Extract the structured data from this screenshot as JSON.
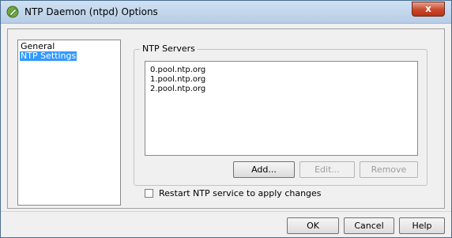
{
  "window": {
    "title": "NTP Daemon (ntpd) Options",
    "close_label": "x"
  },
  "nav": {
    "items": [
      {
        "label": "General"
      },
      {
        "label": "NTP Settings"
      }
    ]
  },
  "ntp_servers": {
    "legend": "NTP Servers",
    "servers": [
      "0.pool.ntp.org",
      "1.pool.ntp.org",
      "2.pool.ntp.org"
    ],
    "add_label": "Add...",
    "edit_label": "Edit...",
    "remove_label": "Remove"
  },
  "restart_option": {
    "label": "Restart NTP service to apply changes",
    "checked": false
  },
  "footer": {
    "ok_label": "OK",
    "cancel_label": "Cancel",
    "help_label": "Help"
  }
}
